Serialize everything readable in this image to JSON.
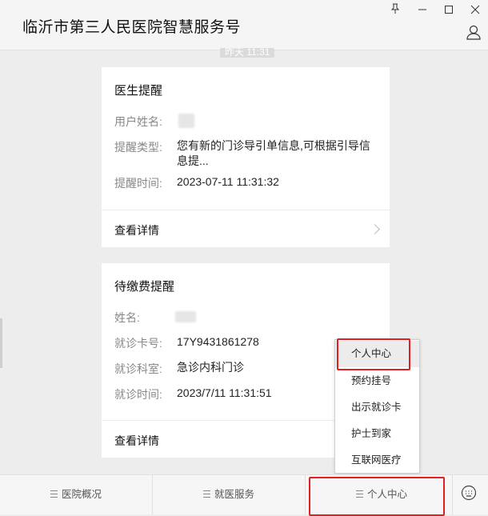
{
  "window": {
    "title": "临沂市第三人民医院智慧服务号",
    "controls": [
      "pin",
      "minimize",
      "maximize",
      "close"
    ]
  },
  "chat": {
    "timestamp": "昨天 11:31"
  },
  "card1": {
    "title": "医生提醒",
    "rows": [
      {
        "label": "用户姓名:",
        "value": ""
      },
      {
        "label": "提醒类型:",
        "value": "您有新的门诊导引单信息,可根据引导信息提..."
      },
      {
        "label": "提醒时间:",
        "value": "2023-07-11 11:31:32"
      }
    ],
    "detail": "查看详情"
  },
  "card2": {
    "title": "待缴费提醒",
    "rows": [
      {
        "label": "姓名:",
        "value": ""
      },
      {
        "label": "就诊卡号:",
        "value": "17Y9431861278"
      },
      {
        "label": "就诊科室:",
        "value": "急诊内科门诊"
      },
      {
        "label": "就诊时间:",
        "value": "2023/7/11 11:31:51"
      }
    ],
    "detail": "查看详情"
  },
  "popup_menu": {
    "items": [
      "个人中心",
      "预约挂号",
      "出示就诊卡",
      "护士到家",
      "互联网医疗"
    ]
  },
  "bottom_menu": {
    "tabs": [
      "医院概况",
      "就医服务",
      "个人中心"
    ]
  },
  "colors": {
    "highlight": "#e02020",
    "background": "#ededed"
  }
}
